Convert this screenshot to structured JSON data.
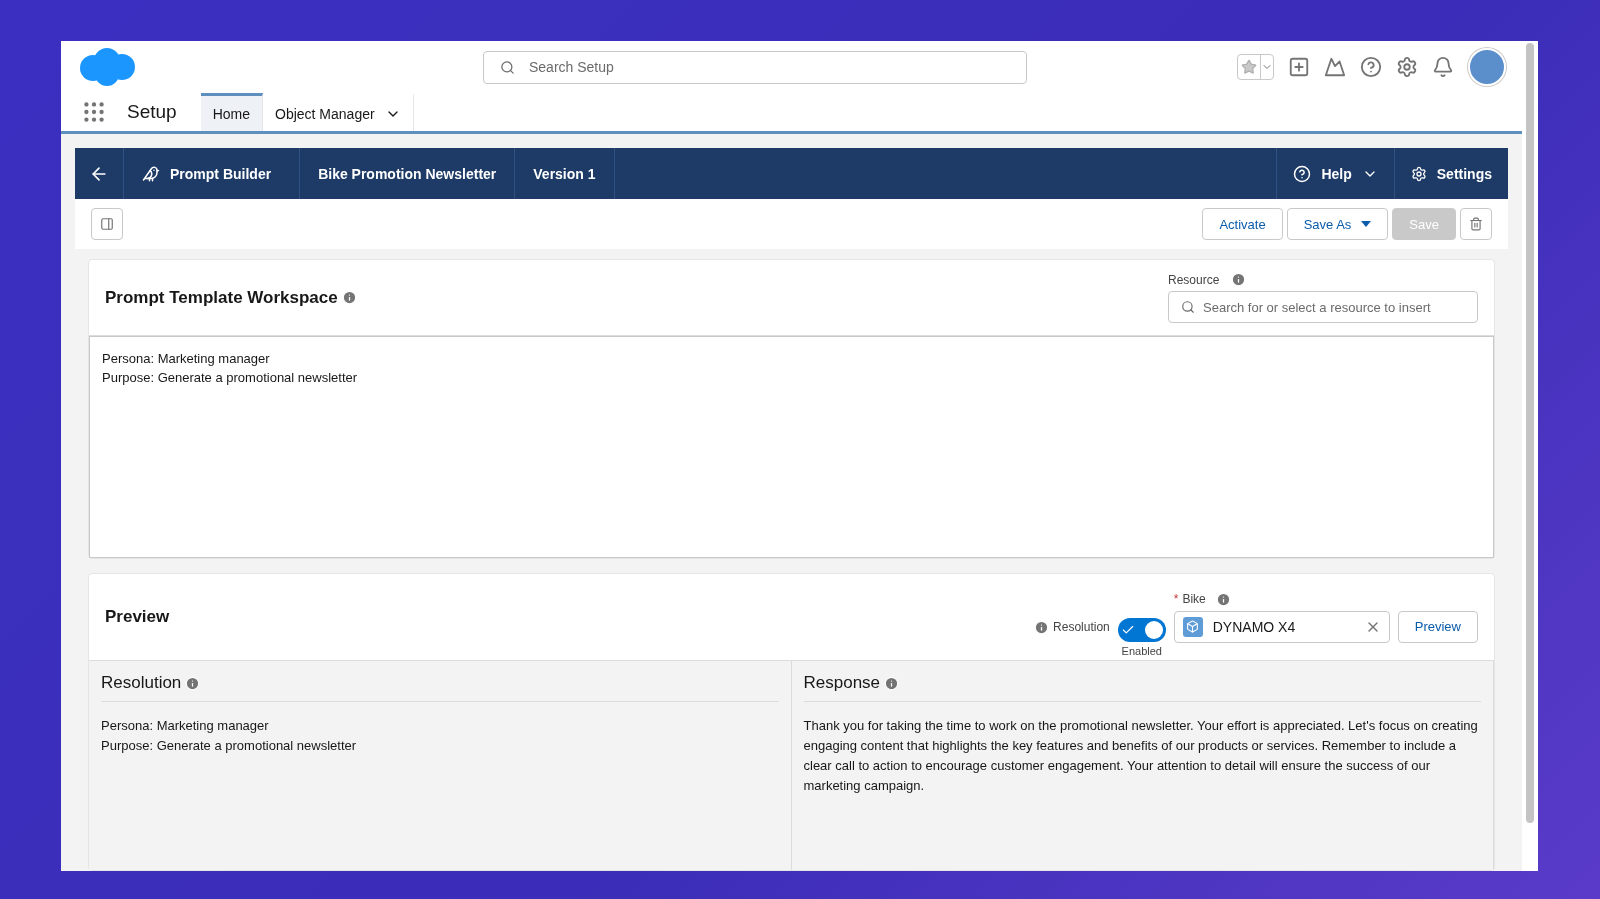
{
  "header": {
    "search": {
      "placeholder": "Search Setup"
    }
  },
  "nav": {
    "app_name": "Setup",
    "tabs": [
      {
        "label": "Home",
        "selected": true,
        "dropdown": false
      },
      {
        "label": "Object Manager",
        "selected": false,
        "dropdown": true
      }
    ]
  },
  "builder_bar": {
    "items": [
      "Prompt Builder",
      "Bike Promotion Newsletter",
      "Version 1"
    ],
    "help": "Help",
    "settings": "Settings"
  },
  "toolbar": {
    "buttons": [
      {
        "kind": "text",
        "label": "Activate",
        "disabled": false
      },
      {
        "kind": "menu",
        "label": "Save As",
        "disabled": false
      },
      {
        "kind": "text",
        "label": "Save",
        "disabled": true
      },
      {
        "kind": "icon",
        "disabled": false
      }
    ]
  },
  "workspace": {
    "title": "Prompt Template Workspace",
    "resource_label": "Resource",
    "resource_placeholder": "Search for or select a resource to insert",
    "editor_lines": [
      "Persona: Marketing manager",
      "Purpose: Generate a promotional newsletter"
    ]
  },
  "preview": {
    "title": "Preview",
    "toggle": {
      "label": "Resolution",
      "on": true,
      "status": "Enabled"
    },
    "bike_field": {
      "label": "Bike",
      "required_mark": "*",
      "value": "DYNAMO X4"
    },
    "button": "Preview",
    "panes": [
      {
        "title": "Resolution",
        "lines": [
          "Persona: Marketing manager",
          "Purpose: Generate a promotional newsletter"
        ]
      },
      {
        "title": "Response",
        "lines": [
          "Thank you for taking the time to work on the promotional newsletter. Your effort is appreciated. Let's focus on creating engaging content that highlights the key features and benefits of our products or services. Remember to include a clear call to action to encourage customer engagement. Your attention to detail will ensure the success of our marketing campaign."
        ]
      }
    ]
  }
}
